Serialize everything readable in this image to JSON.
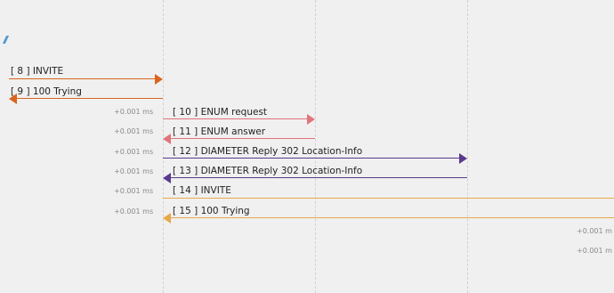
{
  "colors": {
    "invite": "#d9651f",
    "enum": "#e0757a",
    "diameter": "#5a3a8c",
    "invite_forward": "#e8a84a"
  },
  "messages": [
    {
      "id": "m8",
      "label": "[ 8 ] INVITE",
      "timestamp": "",
      "color": "#d9651f",
      "direction": "right"
    },
    {
      "id": "m9",
      "label": "[ 9 ] 100 Trying",
      "timestamp": "",
      "color": "#d9651f",
      "direction": "left"
    },
    {
      "id": "m10",
      "label": "[ 10 ] ENUM request",
      "timestamp": "+0.001 ms",
      "color": "#e0757a",
      "direction": "right"
    },
    {
      "id": "m11",
      "label": "[ 11 ] ENUM answer",
      "timestamp": "+0.001 ms",
      "color": "#e0757a",
      "direction": "left"
    },
    {
      "id": "m12",
      "label": "[ 12 ] DIAMETER Reply 302 Location-Info",
      "timestamp": "+0.001 ms",
      "color": "#5a3a8c",
      "direction": "right"
    },
    {
      "id": "m13",
      "label": "[ 13 ] DIAMETER Reply 302 Location-Info",
      "timestamp": "+0.001 ms",
      "color": "#5a3a8c",
      "direction": "left"
    },
    {
      "id": "m14",
      "label": "[ 14 ] INVITE",
      "timestamp": "+0.001 ms",
      "color": "#e8a84a",
      "direction": "right"
    },
    {
      "id": "m15",
      "label": "[ 15 ] 100 Trying",
      "timestamp": "+0.001 ms",
      "color": "#e8a84a",
      "direction": "left"
    }
  ],
  "trailing_timestamps": [
    "+0.001 m",
    "+0.001 m"
  ]
}
